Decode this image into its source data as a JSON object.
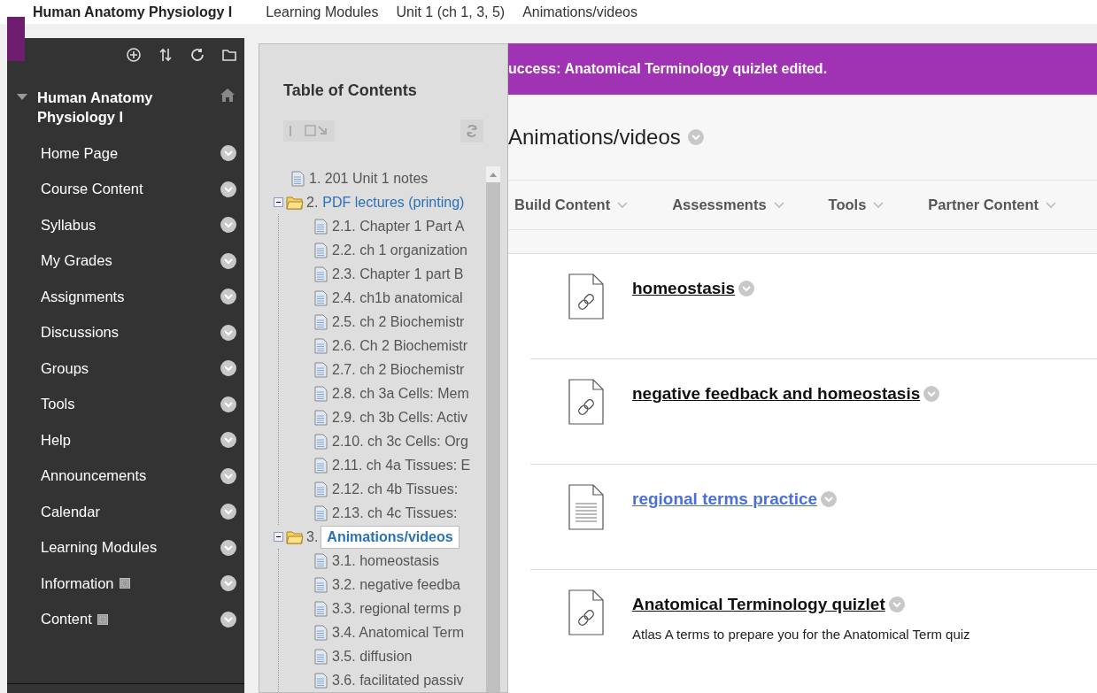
{
  "breadcrumbs": [
    {
      "label": "Human Anatomy Physiology I",
      "kind": "course"
    },
    {
      "label": "Learning Modules",
      "kind": "link"
    },
    {
      "label": "Unit 1 (ch 1, 3, 5)",
      "kind": "link"
    },
    {
      "label": "Animations/videos",
      "kind": "link"
    }
  ],
  "sidebar": {
    "course_title": "Human Anatomy Physiology I",
    "expanded": true,
    "items": [
      {
        "label": "Home Page",
        "has_badge": false
      },
      {
        "label": "Course Content",
        "has_badge": false
      },
      {
        "label": "Syllabus",
        "has_badge": false
      },
      {
        "label": "My Grades",
        "has_badge": false
      },
      {
        "label": "Assignments",
        "has_badge": false
      },
      {
        "label": "Discussions",
        "has_badge": false
      },
      {
        "label": "Groups",
        "has_badge": false
      },
      {
        "label": "Tools",
        "has_badge": false
      },
      {
        "label": "Help",
        "has_badge": false
      },
      {
        "label": "Announcements",
        "has_badge": false
      },
      {
        "label": "Calendar",
        "has_badge": false
      },
      {
        "label": "Learning Modules",
        "has_badge": false
      },
      {
        "label": "Information",
        "has_badge": true
      },
      {
        "label": "Content",
        "has_badge": true
      }
    ]
  },
  "toc": {
    "title": "Table of Contents",
    "tree": [
      {
        "kind": "page",
        "label": "1. 201 Unit 1 notes",
        "selected": false
      },
      {
        "kind": "folder",
        "number": "2.",
        "label": "PDF lectures (printing)",
        "selected": false,
        "expanded": true,
        "children": [
          {
            "kind": "page",
            "label": "2.1. Chapter 1 Part A",
            "selected": false
          },
          {
            "kind": "page",
            "label": "2.2. ch 1 organization",
            "selected": false
          },
          {
            "kind": "page",
            "label": "2.3. Chapter 1 part B",
            "selected": false
          },
          {
            "kind": "page",
            "label": "2.4. ch1b anatomical",
            "selected": false
          },
          {
            "kind": "page",
            "label": "2.5. ch 2 Biochemistr",
            "selected": false
          },
          {
            "kind": "page",
            "label": "2.6. Ch 2 Biochemistr",
            "selected": false
          },
          {
            "kind": "page",
            "label": "2.7. ch 2 Biochemistr",
            "selected": false
          },
          {
            "kind": "page",
            "label": "2.8. ch 3a Cells: Mem",
            "selected": false
          },
          {
            "kind": "page",
            "label": "2.9. ch 3b Cells: Activ",
            "selected": false
          },
          {
            "kind": "page",
            "label": "2.10. ch 3c Cells: Org",
            "selected": false
          },
          {
            "kind": "page",
            "label": "2.11. ch 4a Tissues: E",
            "selected": false
          },
          {
            "kind": "page",
            "label": "2.12. ch 4b Tissues:",
            "selected": false
          },
          {
            "kind": "page",
            "label": "2.13. ch 4c Tissues:",
            "selected": false
          }
        ]
      },
      {
        "kind": "folder",
        "number": "3.",
        "label": "Animations/videos",
        "selected": true,
        "expanded": true,
        "children": [
          {
            "kind": "page",
            "label": "3.1. homeostasis",
            "selected": false
          },
          {
            "kind": "page",
            "label": "3.2. negative feedba",
            "selected": false
          },
          {
            "kind": "page",
            "label": "3.3. regional terms p",
            "selected": false
          },
          {
            "kind": "page",
            "label": "3.4. Anatomical Term",
            "selected": false
          },
          {
            "kind": "page",
            "label": "3.5. diffusion",
            "selected": false
          },
          {
            "kind": "page",
            "label": "3.6. facilitated passiv",
            "selected": false
          }
        ]
      }
    ]
  },
  "message": "uccess: Anatomical Terminology quizlet edited.",
  "page_title": "Animations/videos",
  "toolbar": [
    "Build Content",
    "Assessments",
    "Tools",
    "Partner Content"
  ],
  "content_items": [
    {
      "kind": "link",
      "title": "homeostasis",
      "hovered": false
    },
    {
      "kind": "link",
      "title": "negative feedback and homeostasis",
      "hovered": false
    },
    {
      "kind": "document",
      "title": "regional terms practice",
      "hovered": true
    },
    {
      "kind": "link",
      "title": "Anatomical Terminology quizlet",
      "hovered": false,
      "description": "Atlas A terms to prepare you for the Anatomical Term quiz"
    }
  ]
}
